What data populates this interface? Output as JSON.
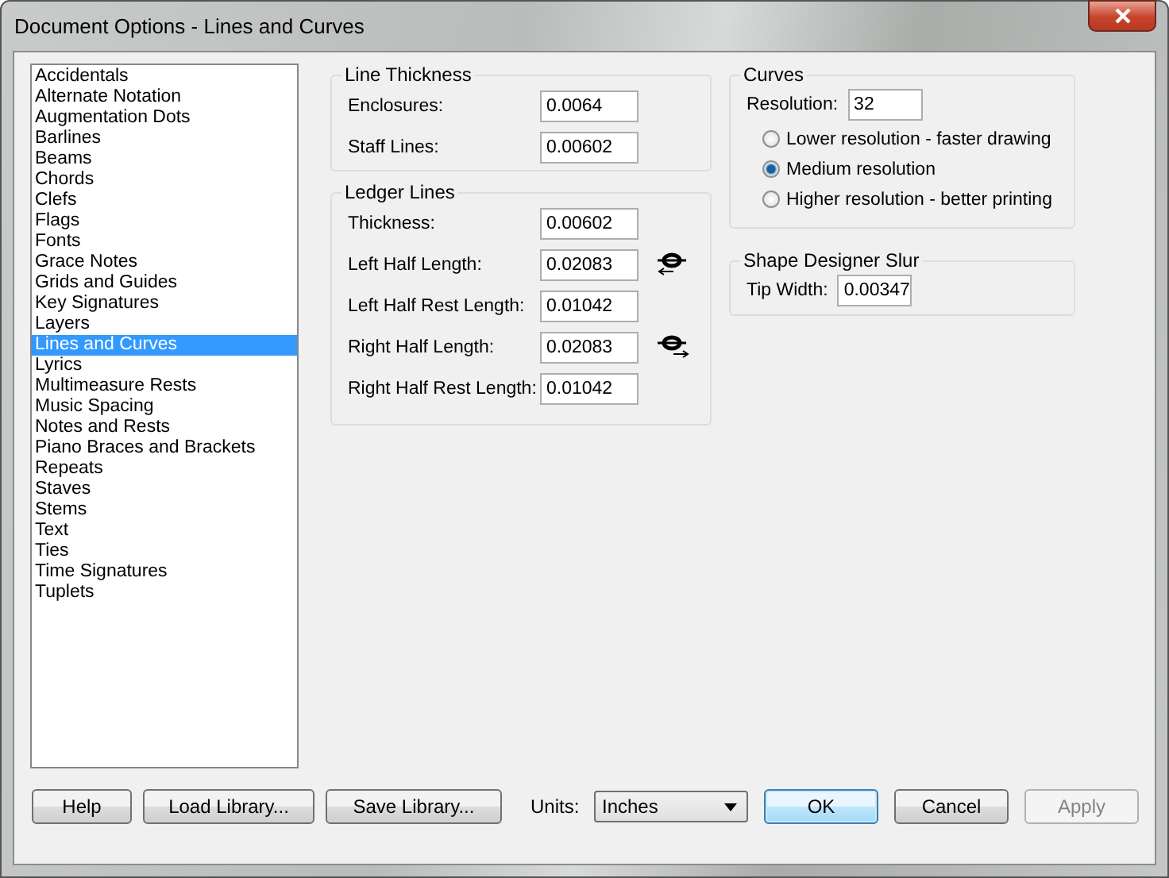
{
  "window": {
    "title": "Document Options - Lines and Curves"
  },
  "sidebar": {
    "items": [
      {
        "label": "Accidentals",
        "selected": false
      },
      {
        "label": "Alternate Notation",
        "selected": false
      },
      {
        "label": "Augmentation Dots",
        "selected": false
      },
      {
        "label": "Barlines",
        "selected": false
      },
      {
        "label": "Beams",
        "selected": false
      },
      {
        "label": "Chords",
        "selected": false
      },
      {
        "label": "Clefs",
        "selected": false
      },
      {
        "label": "Flags",
        "selected": false
      },
      {
        "label": "Fonts",
        "selected": false
      },
      {
        "label": "Grace Notes",
        "selected": false
      },
      {
        "label": "Grids and Guides",
        "selected": false
      },
      {
        "label": "Key Signatures",
        "selected": false
      },
      {
        "label": "Layers",
        "selected": false
      },
      {
        "label": "Lines and Curves",
        "selected": true
      },
      {
        "label": "Lyrics",
        "selected": false
      },
      {
        "label": "Multimeasure Rests",
        "selected": false
      },
      {
        "label": "Music Spacing",
        "selected": false
      },
      {
        "label": "Notes and Rests",
        "selected": false
      },
      {
        "label": "Piano Braces and Brackets",
        "selected": false
      },
      {
        "label": "Repeats",
        "selected": false
      },
      {
        "label": "Staves",
        "selected": false
      },
      {
        "label": "Stems",
        "selected": false
      },
      {
        "label": "Text",
        "selected": false
      },
      {
        "label": "Ties",
        "selected": false
      },
      {
        "label": "Time Signatures",
        "selected": false
      },
      {
        "label": "Tuplets",
        "selected": false
      }
    ]
  },
  "line_thickness": {
    "title": "Line Thickness",
    "fields": [
      {
        "label": "Enclosures:",
        "value": "0.0064"
      },
      {
        "label": "Staff Lines:",
        "value": "0.00602"
      }
    ]
  },
  "ledger_lines": {
    "title": "Ledger Lines",
    "fields": [
      {
        "label": "Thickness:",
        "value": "0.00602",
        "kind": "plain"
      },
      {
        "label": "Left Half Length:",
        "value": "0.02083",
        "kind": "left"
      },
      {
        "label": "Left Half Rest Length:",
        "value": "0.01042",
        "kind": "plain"
      },
      {
        "label": "Right Half Length:",
        "value": "0.02083",
        "kind": "right"
      },
      {
        "label": "Right Half Rest Length:",
        "value": "0.01042",
        "kind": "plain"
      }
    ]
  },
  "curves": {
    "title": "Curves",
    "resolution_label": "Resolution:",
    "resolution_value": "32",
    "options": [
      {
        "label": "Lower resolution - faster drawing",
        "selected": false
      },
      {
        "label": "Medium resolution",
        "selected": true
      },
      {
        "label": "Higher resolution - better printing",
        "selected": false
      }
    ]
  },
  "shape_designer_slur": {
    "title": "Shape Designer Slur",
    "fields": [
      {
        "label": "Tip Width:",
        "value": "0.00347"
      }
    ]
  },
  "footer": {
    "left_buttons": [
      "Help",
      "Load Library...",
      "Save Library..."
    ],
    "units": {
      "label": "Units:",
      "value": "Inches"
    },
    "right_buttons": [
      {
        "label": "OK",
        "default": true,
        "disabled": false
      },
      {
        "label": "Cancel",
        "default": false,
        "disabled": false
      },
      {
        "label": "Apply",
        "default": false,
        "disabled": true
      }
    ]
  }
}
